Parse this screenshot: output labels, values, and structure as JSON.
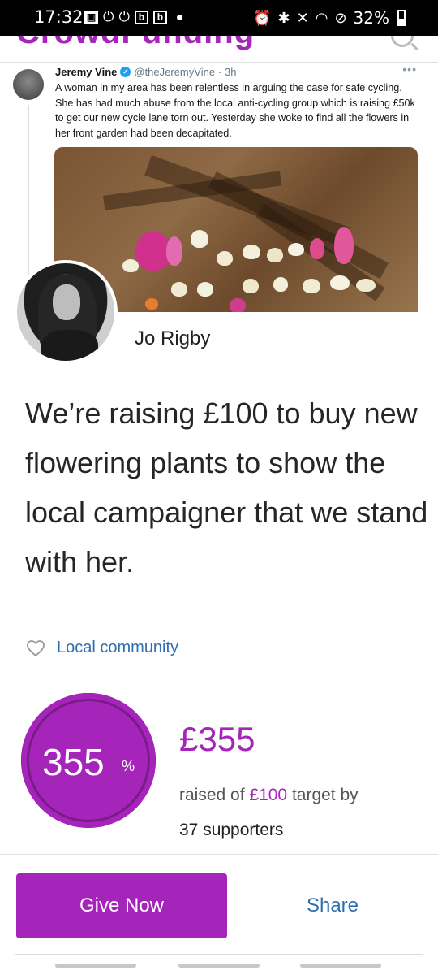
{
  "status_bar": {
    "time": "17:32",
    "left_icons": [
      "gallery-icon",
      "power-icon",
      "power-icon",
      "bbc-b-icon",
      "bbc-b-icon",
      "dot-icon"
    ],
    "battery": "32%"
  },
  "site": {
    "logo_text": "CrowdFunding",
    "brand_color": "#a524b9"
  },
  "cover_tweet": {
    "author": "Jeremy Vine",
    "handle": "@theJeremyVine",
    "age": "· 3h",
    "more": "•••",
    "text": "A woman in my area has been relentless in arguing the case for safe cycling. She has had much abuse from the local anti-cycling group which is raising £50k to get our new cycle lane torn out. Yesterday she woke to find all the flowers in her front garden had been decapitated."
  },
  "profile": {
    "name": "Jo Rigby"
  },
  "headline": "We’re raising £100 to buy new flowering plants to show the local campaigner that we stand with her.",
  "category": {
    "label": "Local community",
    "icon": "heart-icon"
  },
  "progress": {
    "percent": "355",
    "percent_sign": "%",
    "raised": "£355",
    "raised_of_prefix": "raised of ",
    "target": "£100",
    "raised_of_suffix": " target by",
    "supporters": "37 supporters"
  },
  "actions": {
    "give_label": "Give Now",
    "share_label": "Share"
  },
  "colors": {
    "accent": "#a524b9",
    "link": "#2f6fb1"
  }
}
